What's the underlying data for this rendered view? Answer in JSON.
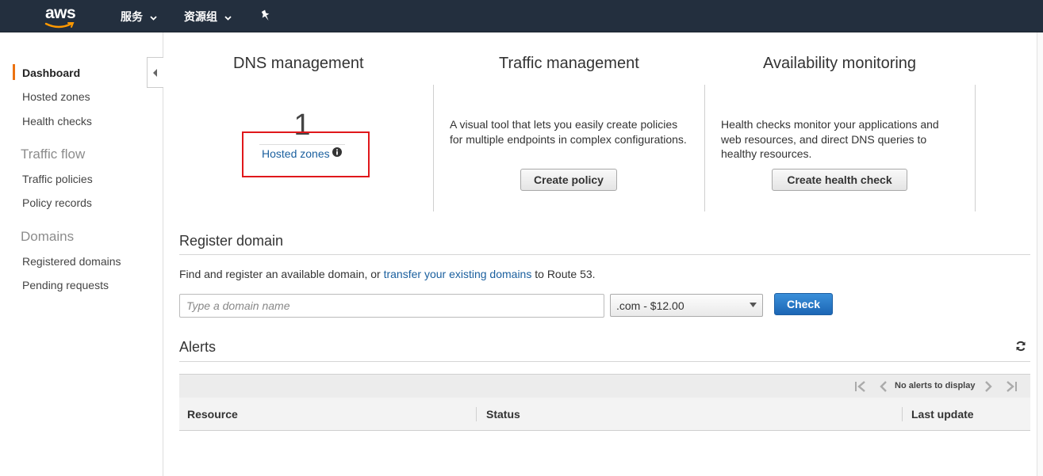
{
  "topbar": {
    "logo_text": "aws",
    "services_label": "服务",
    "resource_groups_label": "资源组",
    "pin_icon": "pushpin-icon"
  },
  "sidebar": {
    "items": [
      {
        "label": "Dashboard",
        "active": true
      },
      {
        "label": "Hosted zones"
      },
      {
        "label": "Health checks"
      },
      {
        "label": "Traffic policies"
      },
      {
        "label": "Policy records"
      },
      {
        "label": "Registered domains"
      },
      {
        "label": "Pending requests"
      }
    ],
    "sections": {
      "traffic_flow": "Traffic flow",
      "domains": "Domains"
    }
  },
  "dns": {
    "title": "DNS management",
    "count": "1",
    "link_label": "Hosted zones"
  },
  "traffic": {
    "title": "Traffic management",
    "description": "A visual tool that lets you easily create policies for multiple endpoints in complex configurations.",
    "button_label": "Create policy"
  },
  "availability": {
    "title": "Availability monitoring",
    "description": "Health checks monitor your applications and web resources, and direct DNS queries to healthy resources.",
    "button_label": "Create health check"
  },
  "register": {
    "title": "Register domain",
    "text_before": "Find and register an available domain, or",
    "link_text": "transfer your existing domains",
    "text_after": "to Route 53.",
    "input_placeholder": "Type a domain name",
    "tld_selected": ".com - $12.00",
    "check_label": "Check"
  },
  "alerts": {
    "title": "Alerts",
    "pager_text": "No alerts to display",
    "columns": [
      "Resource",
      "Status",
      "Last update"
    ]
  },
  "colors": {
    "topbar": "#232f3e",
    "accent": "#ec7211",
    "link": "#1a5f9e",
    "primary_button": "#1c66b5",
    "highlight": "#e0171b"
  }
}
